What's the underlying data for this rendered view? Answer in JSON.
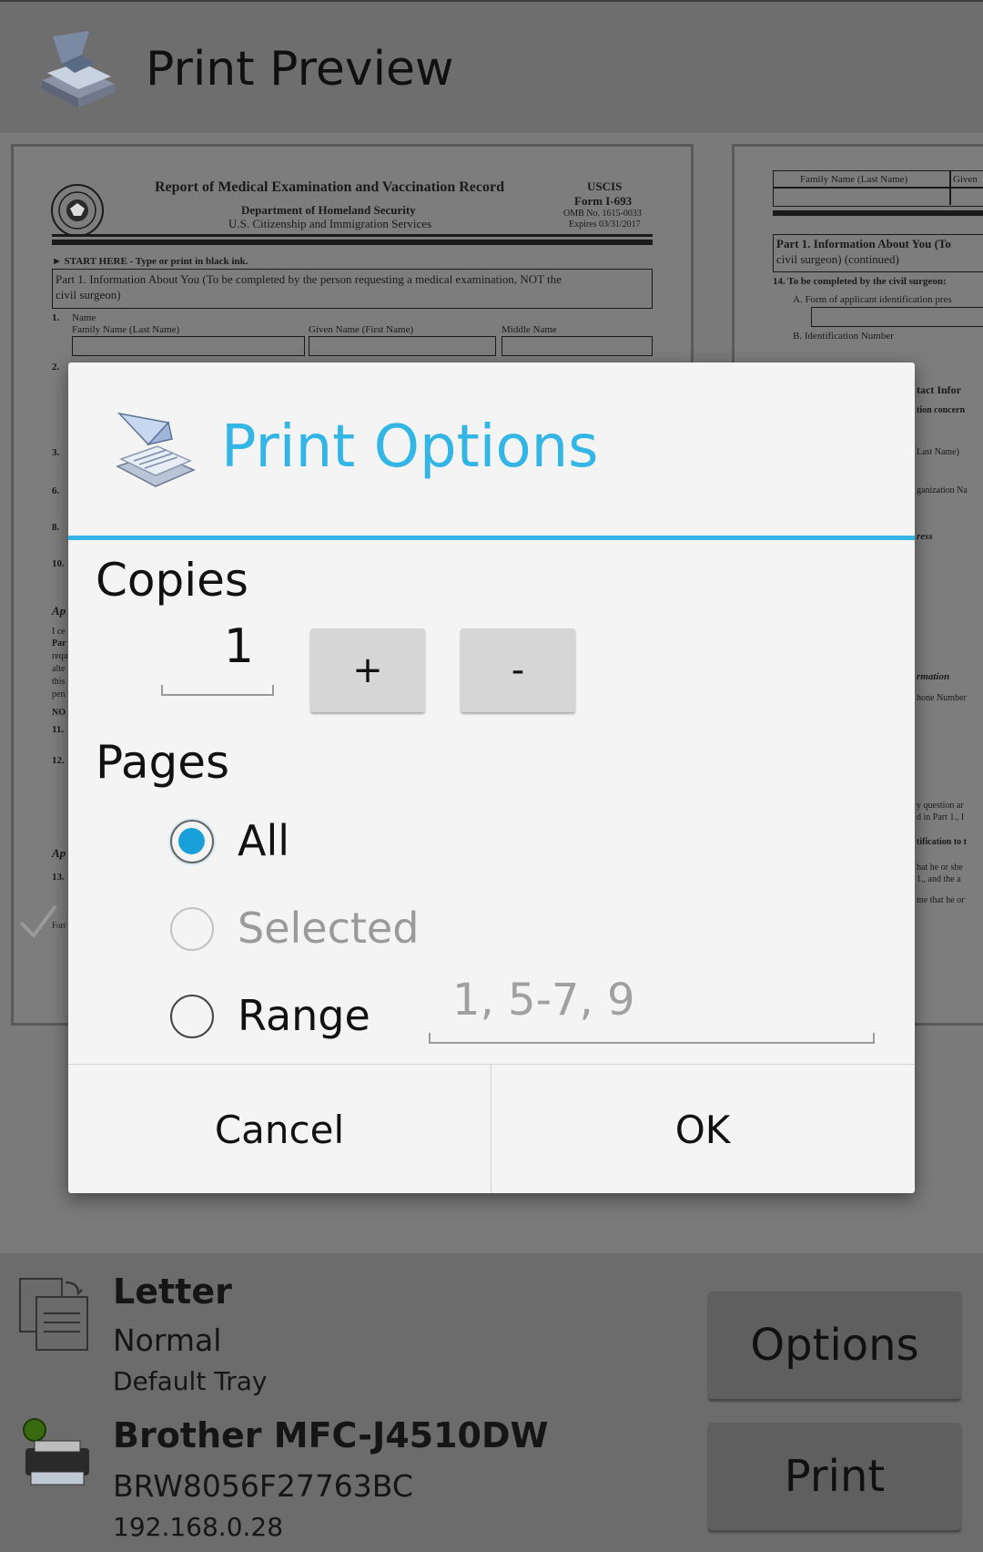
{
  "app_bar": {
    "title": "Print Preview",
    "icon": "print-app-icon"
  },
  "preview": {
    "page1": {
      "header_title": "Report of Medical Examination and Vaccination Record",
      "dept": "Department of Homeland Security",
      "agency": "U.S. Citizenship and Immigration Services",
      "uscis": "USCIS",
      "form": "Form I-693",
      "omb": "OMB No. 1615-0033",
      "expires": "Expires 03/31/2017",
      "start_here": "► START HERE - Type or print in black ink.",
      "part1": "Part 1.  Information About You (To be completed by the person requesting a medical examination, NOT the",
      "part1_cont": "civil surgeon)",
      "item1": "1.",
      "name_label": "Name",
      "family_name": "Family Name (Last Name)",
      "given_name": "Given Name (First Name)",
      "middle_name": "Middle Name",
      "left_nums": [
        "2.",
        "3.",
        "6.",
        "8.",
        "10.",
        "Ap",
        "I ce",
        "Par",
        "requ",
        "alte",
        "this",
        "pen",
        "NO",
        "11.",
        "12.",
        "Ap",
        "13.",
        "Forr"
      ]
    },
    "page2": {
      "family_name": "Family Name (Last Name)",
      "given": "Given",
      "part1": "Part 1.  Information About You (To",
      "part1_cont": "civil surgeon) (continued)",
      "item14": "14.  To be completed by the civil surgeon:",
      "itemA": "A.   Form of applicant identification pres",
      "itemB": "B.   Identification Number",
      "right_frags": [
        "tact Infor",
        "tion concern",
        "Last Name)",
        "ganization Na",
        "ress",
        "rmation",
        "hone Number",
        "y question ar",
        "d in Part 1., I",
        "tification to t",
        "hat he or she",
        "1., and the a",
        "me that he or"
      ]
    }
  },
  "dialog": {
    "title": "Print Options",
    "icon": "print-options-icon",
    "copies_label": "Copies",
    "copies_value": "1",
    "increment_label": "+",
    "decrement_label": "-",
    "pages_label": "Pages",
    "options": [
      {
        "label": "All",
        "state": "checked"
      },
      {
        "label": "Selected",
        "state": "disabled"
      },
      {
        "label": "Range",
        "state": "unchecked"
      }
    ],
    "range_placeholder": "1, 5-7, 9",
    "cancel_label": "Cancel",
    "ok_label": "OK",
    "accent_color": "#33b5e5"
  },
  "bottom": {
    "paper_size": "Letter",
    "quality": "Normal",
    "tray": "Default Tray",
    "printer_name": "Brother MFC-J4510DW",
    "printer_id": "BRW8056F27763BC",
    "printer_ip": "192.168.0.28",
    "options_label": "Options",
    "print_label": "Print",
    "paper_icon": "paper-settings-icon",
    "printer_icon": "printer-icon"
  }
}
